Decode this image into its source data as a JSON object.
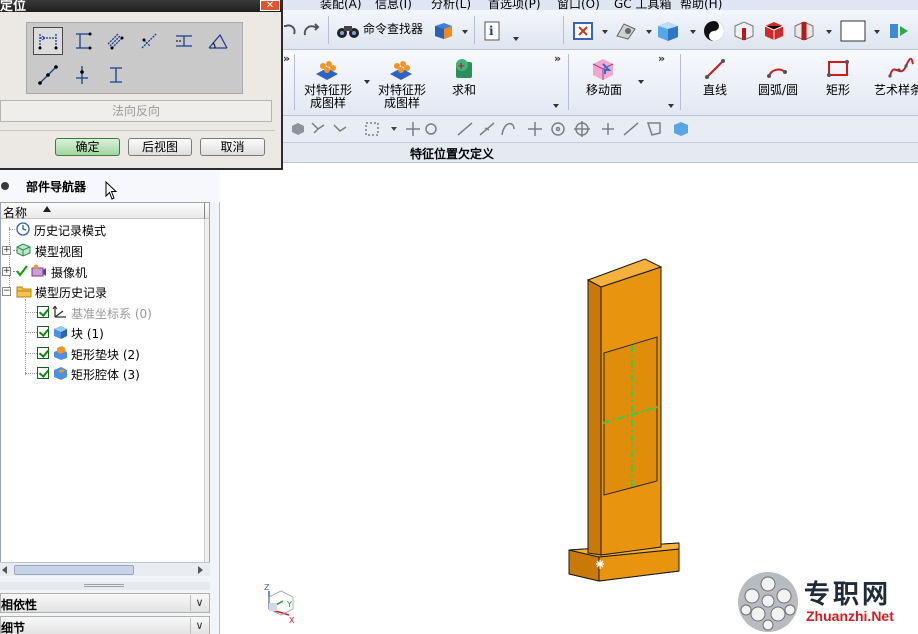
{
  "menubar": {
    "items": [
      "装配(A)",
      "信息(I)",
      "分析(L)",
      "首选项(P)",
      "窗口(O)",
      "GC 工具箱",
      "帮助(H)"
    ]
  },
  "toolbar1": {
    "command_finder": "命令查找器"
  },
  "toolbar2": {
    "pattern_feature_1": "对特征形\n成图样",
    "pattern_feature_2": "对特征形\n成图样",
    "unite": "求和",
    "move_face": "移动面",
    "line": "直线",
    "arc_circle": "圆弧/圆",
    "rectangle": "矩形",
    "studio_spline": "艺术样条"
  },
  "statusbar": {
    "text": "特征位置欠定义"
  },
  "dialog": {
    "title": "定位",
    "reverse_label": "法向反向",
    "ok_label": "确定",
    "back_view_label": "后视图",
    "cancel_label": "取消"
  },
  "navigator": {
    "title": "部件导航器",
    "column_name": "名称",
    "items": [
      {
        "label": "历史记录模式",
        "icon": "clock-icon"
      },
      {
        "label": "模型视图",
        "icon": "model-view-icon"
      },
      {
        "label": "摄像机",
        "icon": "camera-icon"
      },
      {
        "label": "模型历史记录",
        "icon": "folder-icon"
      },
      {
        "label": "基准坐标系 (0)",
        "icon": "datum-csys-icon"
      },
      {
        "label": "块 (1)",
        "icon": "block-icon"
      },
      {
        "label": "矩形垫块 (2)",
        "icon": "pad-icon"
      },
      {
        "label": "矩形腔体 (3)",
        "icon": "pocket-icon"
      }
    ],
    "panel_dependencies": "相依性",
    "panel_details": "细节"
  },
  "watermark": {
    "cn": "专职网",
    "url": "Zhuanzhi.Net"
  },
  "colors": {
    "model_face_front": "#e8940f",
    "model_face_side": "#c97a06",
    "model_face_top": "#f2a21e",
    "centerline": "#2bd14a",
    "toolbar_bg": "#e3e9f3"
  }
}
